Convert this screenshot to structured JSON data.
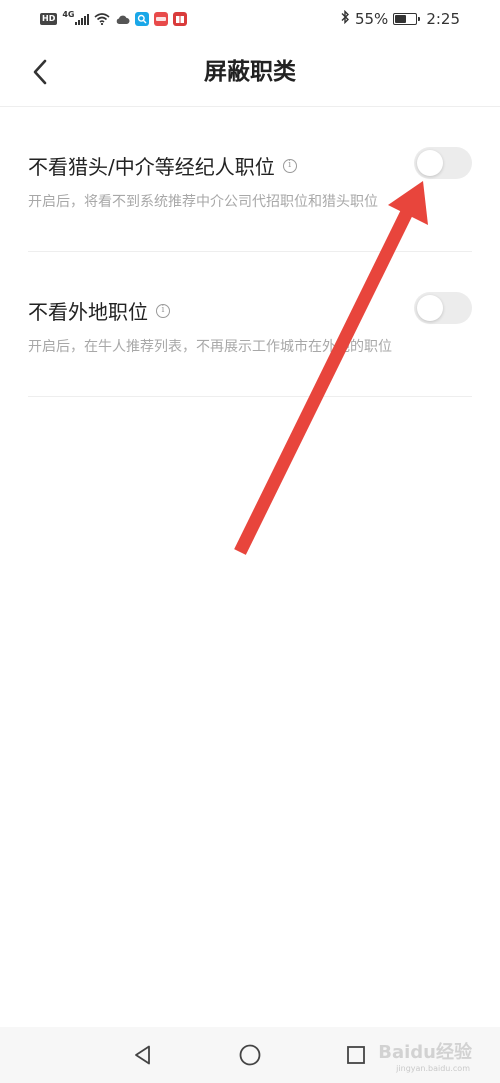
{
  "status_bar": {
    "hd": "HD",
    "network": "4G",
    "battery_percent": "55%",
    "battery_level": 0.55,
    "time": "2:25"
  },
  "header": {
    "title": "屏蔽职类",
    "back_icon": "chevron-left-icon"
  },
  "settings": [
    {
      "title": "不看猎头/中介等经纪人职位",
      "info_icon": "i",
      "description": "开启后，将看不到系统推荐中介公司代招职位和猎头职位",
      "enabled": false
    },
    {
      "title": "不看外地职位",
      "info_icon": "i",
      "description": "开启后，在牛人推荐列表，不再展示工作城市在外地的职位",
      "enabled": false
    }
  ],
  "annotation": {
    "color": "#e8453c"
  },
  "nav_bar": {
    "back_icon": "triangle-back-icon",
    "home_icon": "circle-home-icon",
    "recent_icon": "square-recent-icon"
  },
  "watermark": {
    "text": "Baidu经验",
    "subtext": "jingyan.baidu.com"
  }
}
